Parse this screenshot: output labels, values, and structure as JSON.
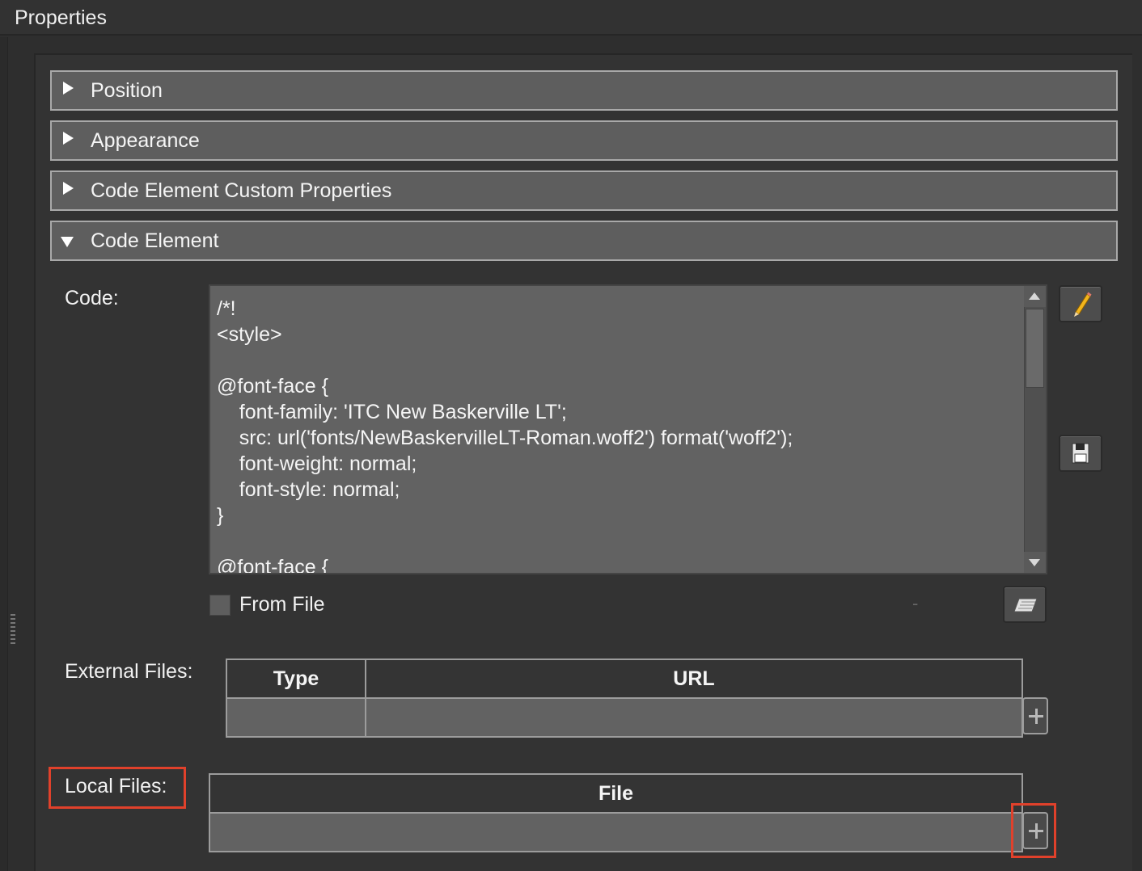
{
  "panel": {
    "title": "Properties"
  },
  "sections": [
    {
      "label": "Position",
      "expanded": false
    },
    {
      "label": "Appearance",
      "expanded": false
    },
    {
      "label": "Code Element Custom Properties",
      "expanded": false
    },
    {
      "label": "Code Element",
      "expanded": true
    }
  ],
  "code_element": {
    "code_label": "Code:",
    "code_text": "/*!\n<style>\n\n@font-face {\n    font-family: 'ITC New Baskerville LT';\n    src: url('fonts/NewBaskervilleLT-Roman.woff2') format('woff2');\n    font-weight: normal;\n    font-style: normal;\n}\n\n@font-face {",
    "from_file_label": "From File",
    "from_file_checked": false,
    "file_path_placeholder": "-",
    "external_files_label": "External Files:",
    "external_columns": [
      "Type",
      "URL"
    ],
    "local_files_label": "Local Files:",
    "local_columns": [
      "File"
    ]
  },
  "icons": {
    "edit": "pencil-icon",
    "save": "floppy-disk-icon",
    "browse": "folder-open-icon",
    "add": "plus-icon"
  },
  "colors": {
    "highlight": "#e0412b",
    "pencil": "#f2b51c"
  }
}
